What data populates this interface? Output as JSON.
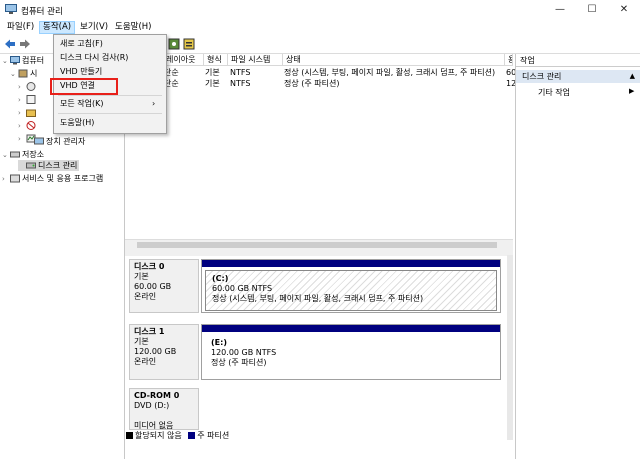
{
  "window": {
    "title": "컴퓨터 관리",
    "minimize_glyph": "—",
    "maximize_glyph": "☐",
    "close_glyph": "✕"
  },
  "menubar": {
    "items": [
      {
        "label": "파일(F)"
      },
      {
        "label": "동작(A)"
      },
      {
        "label": "보기(V)"
      },
      {
        "label": "도움말(H)"
      }
    ]
  },
  "dropdown": {
    "items": [
      {
        "label": "새로 고침(F)"
      },
      {
        "label": "디스크 다시 검사(R)"
      },
      {
        "label": "VHD 만들기"
      },
      {
        "label": "VHD 연결"
      },
      {
        "label": "모든 작업(K)",
        "arrow": "›"
      },
      {
        "label": "도움말(H)"
      }
    ]
  },
  "tree": {
    "items": [
      {
        "label": "컴퓨터"
      },
      {
        "label": "시"
      },
      {
        "label": "장치 관리자"
      },
      {
        "label": "저장소"
      },
      {
        "label": "디스크 관리"
      },
      {
        "label": "서비스 및 응용 프로그램"
      }
    ]
  },
  "volume_table": {
    "columns": [
      "레이아웃",
      "형식",
      "파일 시스템",
      "상태"
    ],
    "extra_col": "용",
    "rows": [
      {
        "volume": "단순",
        "type": "기본",
        "fs": "NTFS",
        "status": "정상 (시스템, 부팅, 페이지 파일, 활성, 크래시 덤프, 주 파티션)",
        "extra": "60"
      },
      {
        "volume": "단순",
        "type": "기본",
        "fs": "NTFS",
        "status": "정상 (주 파티션)",
        "extra": "12"
      }
    ]
  },
  "disks": [
    {
      "name": "디스크 0",
      "type": "기본",
      "size": "60.00 GB",
      "state": "온라인",
      "partition": {
        "label": "(C:)",
        "size": "60.00 GB NTFS",
        "status": "정상 (시스템, 부팅, 페이지 파일, 활성, 크래시 덤프, 주 파티션)"
      }
    },
    {
      "name": "디스크 1",
      "type": "기본",
      "size": "120.00 GB",
      "state": "온라인",
      "partition": {
        "label": "(E:)",
        "size": "120.00 GB NTFS",
        "status": "정상 (주 파티션)"
      }
    },
    {
      "name": "CD-ROM 0",
      "type": "DVD (D:)",
      "size": "",
      "state": "미디어 없음"
    }
  ],
  "legend": [
    {
      "label": "할당되지 않음",
      "color": "#000000"
    },
    {
      "label": "주 파티션",
      "color": "#00007f"
    }
  ],
  "actions": {
    "header": "작업",
    "section": "디스크 관리",
    "section_arrow": "▲",
    "sub": "기타 작업",
    "sub_arrow": "▶"
  },
  "colors": {
    "primary_partition": "#00007f",
    "menu_highlight": "#cce8ff",
    "callout": "#e8201a"
  }
}
